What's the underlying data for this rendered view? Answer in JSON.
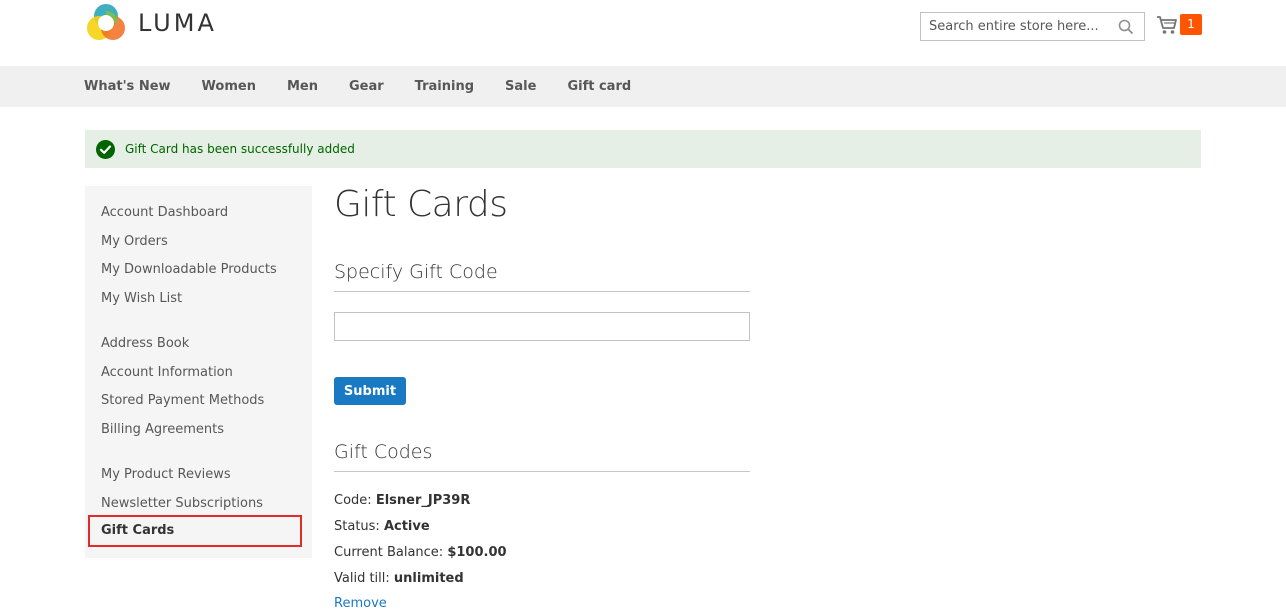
{
  "header": {
    "logo_text": "LUMA",
    "search_placeholder": "Search entire store here...",
    "cart_count": "1"
  },
  "nav": {
    "items": [
      "What's New",
      "Women",
      "Men",
      "Gear",
      "Training",
      "Sale",
      "Gift card"
    ]
  },
  "message": {
    "text": "Gift Card has been successfully added"
  },
  "sidebar": {
    "items": [
      "Account Dashboard",
      "My Orders",
      "My Downloadable Products",
      "My Wish List",
      "Address Book",
      "Account Information",
      "Stored Payment Methods",
      "Billing Agreements",
      "My Product Reviews",
      "Newsletter Subscriptions",
      "Gift Cards"
    ]
  },
  "main": {
    "title": "Gift Cards",
    "specify_title": "Specify Gift Code",
    "code_value": "",
    "submit_label": "Submit",
    "codes_title": "Gift Codes",
    "code_label": "Code:",
    "code": "Elsner_JP39R",
    "status_label": "Status:",
    "status": "Active",
    "balance_label": "Current Balance:",
    "balance": "$100.00",
    "valid_label": "Valid till:",
    "valid": "unlimited",
    "remove_label": "Remove"
  },
  "colors": {
    "accent": "#1979c3",
    "cart_badge": "#ff5501",
    "success_bg": "#e5efe5",
    "success_text": "#006400",
    "highlight_border": "#e02b27"
  }
}
